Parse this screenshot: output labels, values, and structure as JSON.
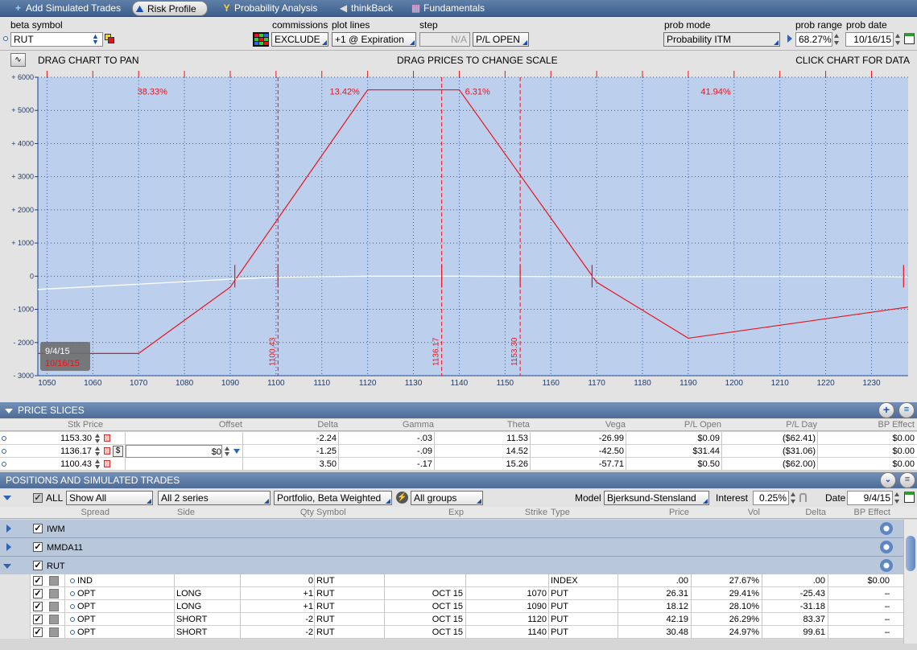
{
  "tabs": [
    {
      "label": "Add Simulated Trades",
      "icon": "plus-icon"
    },
    {
      "label": "Risk Profile",
      "icon": "risk-profile-icon",
      "active": true
    },
    {
      "label": "Probability Analysis",
      "icon": "probability-icon"
    },
    {
      "label": "thinkBack",
      "icon": "thinkback-icon"
    },
    {
      "label": "Fundamentals",
      "icon": "fundamentals-icon"
    }
  ],
  "controls": {
    "beta_symbol_label": "beta symbol",
    "beta_symbol": "RUT",
    "commissions_label": "commissions",
    "commissions": "EXCLUDE",
    "plot_lines_label": "plot lines",
    "plot_lines": "+1 @ Expiration",
    "step_label": "step",
    "step": "N/A",
    "pl_mode": "P/L OPEN",
    "prob_mode_label": "prob mode",
    "prob_mode": "Probability ITM",
    "prob_range_label": "prob range",
    "prob_range": "68.27%",
    "prob_date_label": "prob date",
    "prob_date": "10/16/15"
  },
  "chart_header": {
    "left": "DRAG CHART TO PAN",
    "center": "DRAG PRICES TO CHANGE SCALE",
    "right": "CLICK CHART FOR DATA"
  },
  "chart_data": {
    "type": "line",
    "xlim": [
      1048,
      1238
    ],
    "ylim": [
      -3000,
      6000
    ],
    "x_ticks": [
      1050,
      1060,
      1070,
      1080,
      1090,
      1100,
      1110,
      1120,
      1130,
      1140,
      1150,
      1160,
      1170,
      1180,
      1190,
      1200,
      1210,
      1220,
      1230
    ],
    "y_ticks": [
      6000,
      5000,
      4000,
      3000,
      2000,
      1000,
      0,
      -1000,
      -2000,
      -3000
    ],
    "y_tick_labels": [
      "+ 6000",
      "+ 5000",
      "+ 4000",
      "+ 3000",
      "+ 2000",
      "+ 1000",
      "0",
      "- 1000",
      "- 2000",
      "- 3000"
    ],
    "grid": true,
    "series": [
      {
        "name": "10/16/15",
        "color": "#e8141b",
        "x": [
          1048,
          1070,
          1090,
          1120,
          1140,
          1170,
          1190,
          1238
        ],
        "y": [
          -2330,
          -2330,
          -330,
          5620,
          5620,
          -180,
          -1870,
          -930
        ]
      },
      {
        "name": "9/4/15",
        "color": "#ffffff",
        "x": [
          1048,
          1070,
          1090,
          1100,
          1120,
          1140,
          1160,
          1170,
          1180,
          1200,
          1220,
          1238
        ],
        "y": [
          -400,
          -240,
          -90,
          -30,
          0,
          0,
          -10,
          -20,
          -20,
          -10,
          -10,
          -20
        ]
      }
    ],
    "price_slices": [
      1100.43,
      1136.17,
      1153.3
    ],
    "prob_range_markers": [
      1091,
      1169
    ],
    "bound_markers": [
      1100.43,
      1136.17,
      1153.3,
      1237
    ],
    "probabilities": [
      {
        "label": "38.33%",
        "x": 1073,
        "y": 5500
      },
      {
        "label": "13.42%",
        "x": 1115,
        "y": 5500
      },
      {
        "label": "6.31%",
        "x": 1144,
        "y": 5500
      },
      {
        "label": "41.94%",
        "x": 1196,
        "y": 5500
      }
    ],
    "legend": {
      "placement": "bottom-left",
      "entries": [
        "9/4/15",
        "10/16/15"
      ]
    }
  },
  "price_slices_section": {
    "title": "PRICE SLICES",
    "columns": [
      "Stk Price",
      "Offset",
      "Delta",
      "Gamma",
      "Theta",
      "Vega",
      "P/L Open",
      "P/L Day",
      "BP Effect"
    ],
    "rows": [
      {
        "price": "1153.30",
        "offset": "",
        "delta": "-2.24",
        "gamma": "-.03",
        "theta": "11.53",
        "vega": "-26.99",
        "pl_open": "$0.09",
        "pl_day": "($62.41)",
        "bp": "$0.00"
      },
      {
        "price": "1136.17",
        "offset": "$0",
        "delta": "-1.25",
        "gamma": "-.09",
        "theta": "14.52",
        "vega": "-42.50",
        "pl_open": "$31.44",
        "pl_day": "($31.06)",
        "bp": "$0.00"
      },
      {
        "price": "1100.43",
        "offset": "",
        "delta": "3.50",
        "gamma": "-.17",
        "theta": "15.26",
        "vega": "-57.71",
        "pl_open": "$0.50",
        "pl_day": "($62.00)",
        "bp": "$0.00"
      }
    ]
  },
  "positions": {
    "title": "POSITIONS AND SIMULATED TRADES",
    "filter_all": "ALL",
    "show": "Show All",
    "series": "All 2 series",
    "portfolio": "Portfolio, Beta Weighted",
    "groups": "All groups",
    "model_label": "Model",
    "model": "Bjerksund-Stensland",
    "interest_label": "Interest",
    "interest": "0.25%",
    "date_label": "Date",
    "date": "9/4/15",
    "columns": [
      "Spread",
      "Side",
      "Qty",
      "Symbol",
      "Exp",
      "Strike",
      "Type",
      "Price",
      "Vol",
      "Delta",
      "BP Effect"
    ],
    "groups_list": [
      {
        "name": "IWM",
        "expanded": false
      },
      {
        "name": "MMDA11",
        "expanded": false
      },
      {
        "name": "RUT",
        "expanded": true
      }
    ],
    "rows": [
      {
        "spread": "IND",
        "side": "",
        "qty": "0",
        "symbol": "RUT",
        "exp": "",
        "strike": "",
        "type": "INDEX",
        "price": ".00",
        "vol": "27.67%",
        "delta": ".00",
        "bp": "$0.00"
      },
      {
        "spread": "OPT",
        "side": "LONG",
        "qty": "+1",
        "symbol": "RUT",
        "exp": "OCT 15",
        "strike": "1070",
        "type": "PUT",
        "price": "26.31",
        "vol": "29.41%",
        "delta": "-25.43",
        "bp": "–"
      },
      {
        "spread": "OPT",
        "side": "LONG",
        "qty": "+1",
        "symbol": "RUT",
        "exp": "OCT 15",
        "strike": "1090",
        "type": "PUT",
        "price": "18.12",
        "vol": "28.10%",
        "delta": "-31.18",
        "bp": "–"
      },
      {
        "spread": "OPT",
        "side": "SHORT",
        "qty": "-2",
        "symbol": "RUT",
        "exp": "OCT 15",
        "strike": "1120",
        "type": "PUT",
        "price": "42.19",
        "vol": "26.29%",
        "delta": "83.37",
        "bp": "–"
      },
      {
        "spread": "OPT",
        "side": "SHORT",
        "qty": "-2",
        "symbol": "RUT",
        "exp": "OCT 15",
        "strike": "1140",
        "type": "PUT",
        "price": "30.48",
        "vol": "24.97%",
        "delta": "99.61",
        "bp": "–"
      }
    ]
  }
}
